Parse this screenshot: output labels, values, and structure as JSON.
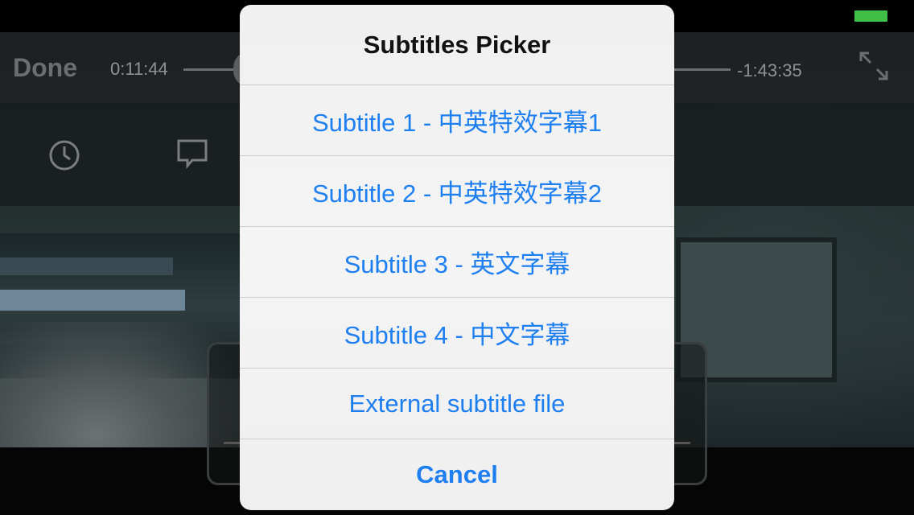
{
  "player": {
    "done_label": "Done",
    "time_elapsed": "0:11:44",
    "time_remaining": "-1:43:35"
  },
  "picker": {
    "title": "Subtitles Picker",
    "options": [
      "Subtitle 1 - 中英特效字幕1",
      "Subtitle 2 - 中英特效字幕2",
      "Subtitle 3 - 英文字幕",
      "Subtitle 4 - 中文字幕",
      "External subtitle file"
    ],
    "cancel_label": "Cancel"
  },
  "icons": {
    "clock": "clock-icon",
    "subtitles": "chat-bubble-icon",
    "fullscreen": "fullscreen-icon"
  },
  "colors": {
    "accent": "#1e7ff0",
    "battery": "#3fbf45"
  }
}
